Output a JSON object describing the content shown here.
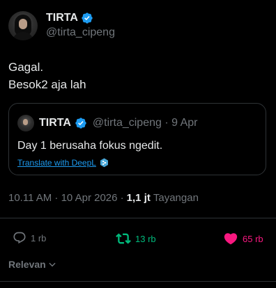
{
  "author": {
    "display_name": "TIRTA",
    "handle": "@tirta_cipeng",
    "verified": true
  },
  "tweet": {
    "lines": [
      "Gagal.",
      "Besok2 aja lah"
    ]
  },
  "quote": {
    "display_name": "TIRTA",
    "handle_date": "@tirta_cipeng · 9 Apr",
    "text": "Day 1 berusaha fokus ngedit.",
    "translate_label": "Translate with DeepL"
  },
  "meta": {
    "timestamp": "10.11 AM · 10 Apr 2026 ·",
    "views_count": "1,1 jt",
    "views_label": "Tayangan"
  },
  "actions": {
    "reply_count": "1 rb",
    "retweet_count": "13 rb",
    "like_count": "65 rb"
  },
  "sort": {
    "label": "Relevan"
  },
  "colors": {
    "background": "#000000",
    "text": "#e7e9ea",
    "muted": "#71767b",
    "link": "#1d9bf0",
    "retweet": "#00ba7c",
    "like": "#f91880",
    "border": "#2f3336"
  }
}
